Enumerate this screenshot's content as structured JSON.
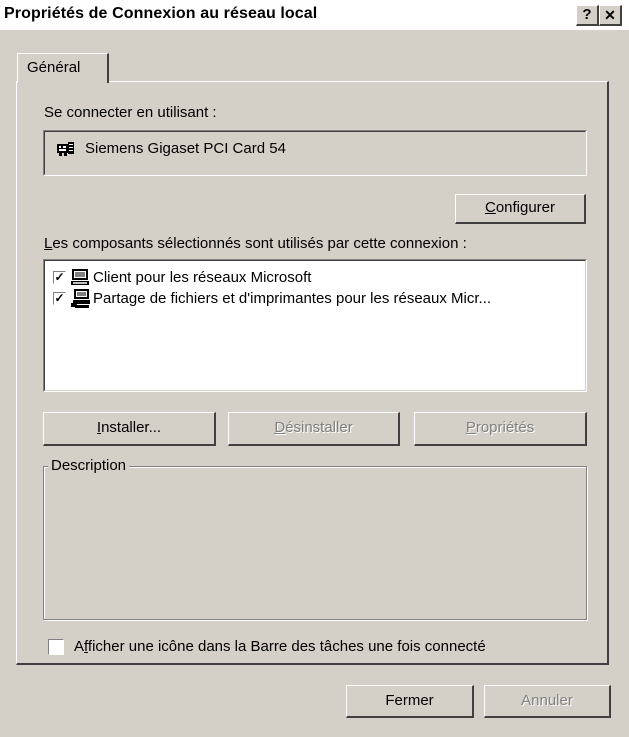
{
  "window": {
    "title": "Propriétés de Connexion au réseau local",
    "help_button": "?",
    "close_button": "✕"
  },
  "tabs": [
    {
      "label": "Général",
      "active": true
    }
  ],
  "connect_using": {
    "label": "Se connecter en utilisant :",
    "adapter_name": "Siemens Gigaset PCI Card 54",
    "adapter_icon": "network-card-icon"
  },
  "configure_button": {
    "label_pre": "",
    "accel": "C",
    "label_post": "onfigurer"
  },
  "components": {
    "label_accel": "L",
    "label_rest": "es composants sélectionnés sont utilisés par cette connexion :",
    "items": [
      {
        "label": "Client pour les réseaux Microsoft",
        "checked": true,
        "icon": "network-client-icon"
      },
      {
        "label": "Partage de fichiers et d'imprimantes pour les réseaux Micr...",
        "checked": true,
        "icon": "file-printer-sharing-icon"
      }
    ]
  },
  "buttons": {
    "install": {
      "accel": "I",
      "rest": "nstaller..."
    },
    "uninstall": {
      "accel": "D",
      "rest": "ésinstaller",
      "disabled": true
    },
    "properties": {
      "accel": "P",
      "rest": "ropriétés",
      "disabled": true
    }
  },
  "description": {
    "title": "Description",
    "text": ""
  },
  "taskbar_checkbox": {
    "pre": "A",
    "accel": "f",
    "post": "ficher une icône dans la Barre des tâches une fois connecté",
    "checked": false
  },
  "footer": {
    "close_label": "Fermer",
    "cancel_label": "Annuler",
    "cancel_disabled": true
  },
  "colors": {
    "face": "#d4d0c8",
    "shadow": "#808080",
    "dark": "#404040",
    "disabled_text": "#808080"
  }
}
